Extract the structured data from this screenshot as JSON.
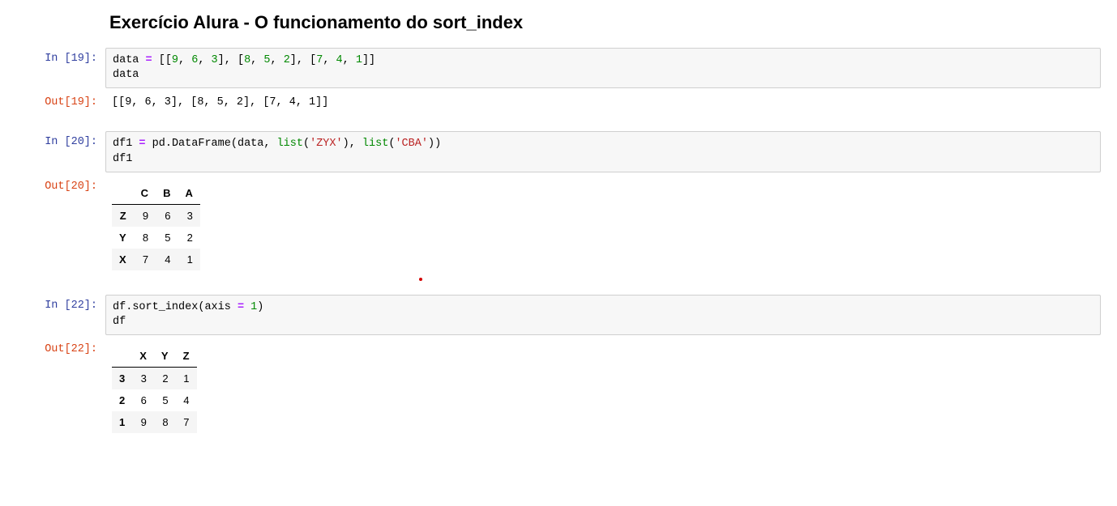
{
  "heading": "Exercício Alura - O funcionamento do sort_index",
  "prompts": {
    "in19": "In [19]:",
    "out19": "Out[19]:",
    "in20": "In [20]:",
    "out20": "Out[20]:",
    "in22": "In [22]:",
    "out22": "Out[22]:"
  },
  "cell19": {
    "tok_data": "data",
    "tok_eq": " = ",
    "tok_list": "[[",
    "n9": "9",
    "c": ", ",
    "n6": "6",
    "n3": "3",
    "mid": "], [",
    "n8": "8",
    "n5": "5",
    "n2": "2",
    "n7": "7",
    "n4": "4",
    "n1": "1",
    "end": "]]",
    "line2": "data"
  },
  "out19_text": "[[9, 6, 3], [8, 5, 2], [7, 4, 1]]",
  "cell20": {
    "df1": "df1",
    "eq": " = ",
    "pd": "pd",
    "dot": ".",
    "fn": "DataFrame",
    "op": "(",
    "data": "data",
    "c": ", ",
    "list": "list",
    "zyx": "'ZYX'",
    "cba": "'CBA'",
    "cp": ")",
    "line2": "df1"
  },
  "df1": {
    "columns": [
      "C",
      "B",
      "A"
    ],
    "index": [
      "Z",
      "Y",
      "X"
    ],
    "data": [
      [
        "9",
        "6",
        "3"
      ],
      [
        "8",
        "5",
        "2"
      ],
      [
        "7",
        "4",
        "1"
      ]
    ]
  },
  "cell22": {
    "df": "df",
    "dot": ".",
    "fn": "sort_index",
    "op": "(",
    "axis": "axis",
    "eq": " = ",
    "one": "1",
    "cp": ")",
    "line2": "df"
  },
  "df2": {
    "columns": [
      "X",
      "Y",
      "Z"
    ],
    "index": [
      "3",
      "2",
      "1"
    ],
    "data": [
      [
        "3",
        "2",
        "1"
      ],
      [
        "6",
        "5",
        "4"
      ],
      [
        "9",
        "8",
        "7"
      ]
    ]
  }
}
